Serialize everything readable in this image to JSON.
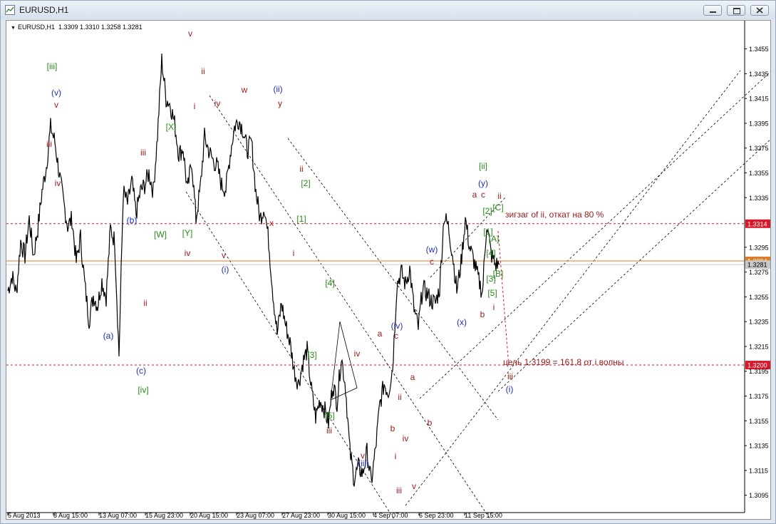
{
  "window": {
    "title": "EURUSD,H1",
    "icon": "chart-window-icon",
    "controls": [
      "minimize-icon",
      "restore-icon",
      "close-icon"
    ]
  },
  "header": {
    "symbol": "EURUSD,H1",
    "ohlc": "1.3309 1.3310 1.3258 1.3281"
  },
  "chart_data": {
    "type": "line",
    "title": "",
    "xlabel": "",
    "ylabel": "",
    "ylim": [
      1.3085,
      1.3468
    ],
    "grid": false,
    "x_ticks": [
      "5 Aug 2013",
      "8 Aug 15:00",
      "13 Aug 07:00",
      "15 Aug 23:00",
      "20 Aug 15:00",
      "23 Aug 07:00",
      "27 Aug 23:00",
      "30 Aug 15:00",
      "4 Sep 07:00",
      "6 Sep 23:00",
      "11 Sep 15:00"
    ],
    "y_ticks": [
      "1.3455",
      "1.3435",
      "1.3415",
      "1.3395",
      "1.3375",
      "1.3355",
      "1.3335",
      "1.3314",
      "1.3295",
      "1.3284",
      "1.3281",
      "1.3275",
      "1.3255",
      "1.3235",
      "1.3215",
      "1.3200",
      "1.3195",
      "1.3175",
      "1.3155",
      "1.3135",
      "1.3115",
      "1.3095"
    ],
    "series": [
      {
        "x": [
          0,
          6,
          12,
          18,
          24,
          30,
          36,
          42,
          48,
          54,
          60,
          66,
          72,
          78,
          84,
          90,
          96,
          102,
          108,
          114,
          120,
          126,
          132,
          138,
          144,
          150,
          156,
          162,
          168,
          174,
          180,
          186,
          192,
          198,
          204,
          210,
          216,
          222,
          228,
          234,
          240,
          246,
          252,
          258,
          264,
          270,
          276,
          282,
          288,
          294,
          300,
          306,
          312,
          318,
          324,
          330,
          336,
          342,
          348,
          354,
          360,
          366,
          372,
          378,
          384,
          390,
          396,
          402,
          408,
          414,
          420,
          426,
          432,
          438,
          444,
          450,
          456,
          462,
          468,
          474,
          480,
          486,
          492,
          498,
          504,
          510,
          516,
          522,
          528,
          534,
          540,
          546,
          552,
          558,
          564,
          570,
          576,
          582,
          588,
          594,
          600,
          606,
          612,
          618,
          624,
          630,
          636,
          642,
          648,
          654,
          660,
          666,
          672,
          678,
          684,
          690
        ],
        "y": [
          1.326,
          1.3272,
          1.3258,
          1.33,
          1.3288,
          1.3318,
          1.3288,
          1.331,
          1.334,
          1.336,
          1.3392,
          1.338,
          1.3355,
          1.3332,
          1.3312,
          1.3318,
          1.3283,
          1.3303,
          1.3265,
          1.3236,
          1.3256,
          1.3248,
          1.3268,
          1.3255,
          1.331,
          1.33,
          1.3208,
          1.334,
          1.333,
          1.3348,
          1.3322,
          1.334,
          1.3345,
          1.3355,
          1.334,
          1.3385,
          1.3446,
          1.3415,
          1.341,
          1.3395,
          1.337,
          1.3375,
          1.334,
          1.3365,
          1.3318,
          1.3342,
          1.3384,
          1.3373,
          1.3365,
          1.336,
          1.3345,
          1.3342,
          1.337,
          1.3392,
          1.3398,
          1.339,
          1.3373,
          1.338,
          1.334,
          1.3318,
          1.3328,
          1.33,
          1.3258,
          1.3225,
          1.325,
          1.3232,
          1.3218,
          1.3195,
          1.3185,
          1.3202,
          1.3212,
          1.318,
          1.3158,
          1.3172,
          1.3165,
          1.3153,
          1.3185,
          1.317,
          1.3207,
          1.3182,
          1.313,
          1.3108,
          1.3118,
          1.3112,
          1.313,
          1.3105,
          1.3132,
          1.3168,
          1.3185,
          1.3178,
          1.3198,
          1.3265,
          1.3275,
          1.3265,
          1.3278,
          1.3245,
          1.323,
          1.3262,
          1.3258,
          1.3252,
          1.325,
          1.3262,
          1.332,
          1.3312,
          1.329,
          1.326,
          1.3282,
          1.3318,
          1.3295,
          1.3284,
          1.327,
          1.3258,
          1.3315,
          1.329,
          1.3281,
          1.3281
        ],
        "color": "#000000"
      }
    ],
    "annotations": {
      "labels": [
        "[iii]",
        "(v)",
        "v",
        "iii",
        "iv",
        "(b)",
        "(a)",
        "(c)",
        "[iv]",
        "iii",
        "ii",
        "[X]",
        "[W]",
        "[Y]",
        "iv",
        "v",
        "ii",
        "i",
        "iv",
        "v",
        "(i)",
        "w",
        "(ii)",
        "y",
        "x",
        "ii",
        "[2]",
        "[1]",
        "i",
        "[4]",
        "[3]",
        "[5]",
        "iii",
        "iv",
        "v",
        "(iii)",
        "a",
        "c",
        "(iv)",
        "b",
        "ii",
        "i",
        "iv",
        "iii",
        "v",
        "a",
        "b",
        "(w)",
        "c",
        "(x)",
        "b",
        "[ii]",
        "(y)",
        "a",
        "c",
        "ii",
        "[2]",
        "[C]",
        "[1]",
        "[A]",
        "[4]",
        "[B]",
        "[3]",
        "[5]",
        "i",
        "iii",
        "(i)"
      ],
      "notes": [
        "зигзаг of ii, откат на 80 %",
        "цель 1.3199 = 161.8 от i волны"
      ]
    },
    "levels": [
      {
        "value": "1.3314",
        "color": "#d9182b"
      },
      {
        "value": "1.3284",
        "color": "#e07a24"
      },
      {
        "value": "1.3281",
        "color": "#c8c8c8"
      },
      {
        "value": "1.3200",
        "color": "#d9182b"
      }
    ]
  }
}
